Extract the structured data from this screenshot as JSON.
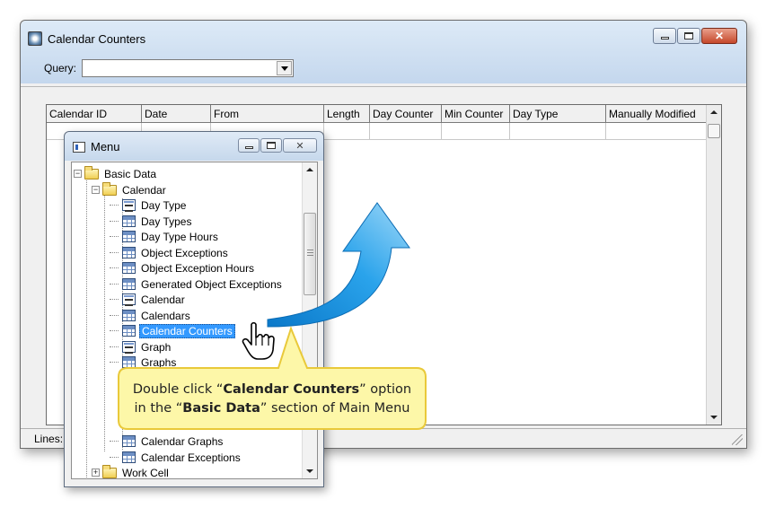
{
  "main_window": {
    "title": "Calendar Counters",
    "query_label": "Query:",
    "query_value": "",
    "status_text": "Lines:"
  },
  "grid": {
    "columns": [
      "Calendar ID",
      "Date",
      "From",
      "Length",
      "Day Counter",
      "Min Counter",
      "Day Type",
      "Manually Modified"
    ]
  },
  "menu_window": {
    "title": "Menu",
    "tree": [
      {
        "label": "Basic Data",
        "icon": "folder-icon",
        "level": 0,
        "expander": "minus"
      },
      {
        "label": "Calendar",
        "icon": "folder-icon",
        "level": 1,
        "expander": "minus"
      },
      {
        "label": "Day Type",
        "icon": "form-icon",
        "level": 2
      },
      {
        "label": "Day Types",
        "icon": "grid-icon",
        "level": 2
      },
      {
        "label": "Day Type Hours",
        "icon": "grid-icon",
        "level": 2
      },
      {
        "label": "Object Exceptions",
        "icon": "grid-icon",
        "level": 2
      },
      {
        "label": "Object Exception Hours",
        "icon": "grid-icon",
        "level": 2
      },
      {
        "label": "Generated Object Exceptions",
        "icon": "grid-icon",
        "level": 2
      },
      {
        "label": "Calendar",
        "icon": "form-icon",
        "level": 2
      },
      {
        "label": "Calendars",
        "icon": "grid-icon",
        "level": 2
      },
      {
        "label": "Calendar Counters",
        "icon": "grid-icon",
        "level": 2,
        "selected": true
      },
      {
        "label": "Graph",
        "icon": "form-icon",
        "level": 2
      },
      {
        "label": "Graphs",
        "icon": "grid-icon",
        "level": 2
      },
      {
        "label": "Calendar Graphs",
        "icon": "grid-icon",
        "level": 2
      },
      {
        "label": "Calendar Exceptions",
        "icon": "grid-icon",
        "level": 2
      },
      {
        "label": "Work Cell",
        "icon": "folder-icon",
        "level": 1,
        "expander": "plus"
      }
    ]
  },
  "callout": {
    "line1_pre": "Double click “",
    "line1_bold": "Calendar Counters",
    "line1_post": "” option",
    "line2_pre": "in the “",
    "line2_bold": "Basic Data",
    "line2_post": "” section of Main Menu"
  },
  "colors": {
    "selection": "#3399ff",
    "callout_fill": "#fdf7a8",
    "callout_border": "#e9c93a",
    "arrow_light": "#9fd8f8",
    "arrow_dark": "#0a78c9"
  }
}
